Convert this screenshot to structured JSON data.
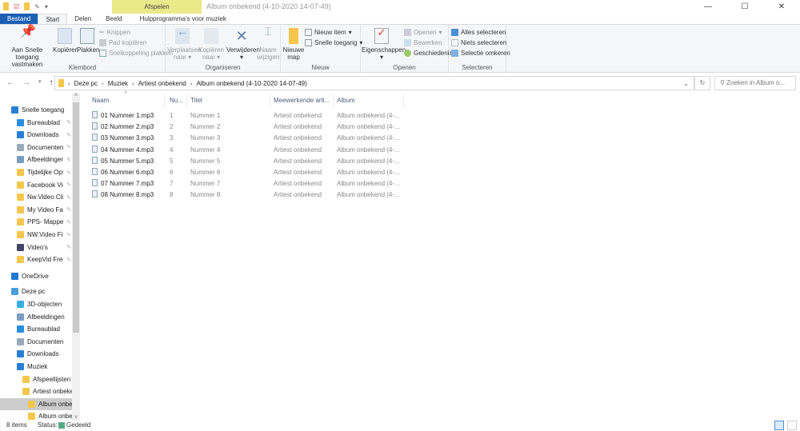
{
  "window": {
    "title": "Album onbekend (4-10-2020 14-07-49)",
    "contextual_tab": "Afspelen"
  },
  "tabs": [
    "Bestand",
    "Start",
    "Delen",
    "Beeld",
    "Hulpprogramma's voor muziek"
  ],
  "ribbon": {
    "klembord": {
      "label": "Klembord",
      "pin": "Aan Snelle toegang vastmaken",
      "copy": "Kopiëren",
      "paste": "Plakken",
      "cut": "Knippen",
      "copy_path": "Pad kopiëren",
      "paste_shortcut": "Snelkoppeling plakken"
    },
    "organiseren": {
      "label": "Organiseren",
      "move": "Verplaatsen naar",
      "copy_to": "Kopiëren naar",
      "delete": "Verwijderen",
      "rename": "Naam wijzigen"
    },
    "nieuw": {
      "label": "Nieuw",
      "new_folder": "Nieuwe map",
      "new_item": "Nieuw item",
      "easy_access": "Snelle toegang"
    },
    "openen": {
      "label": "Openen",
      "properties": "Eigenschappen",
      "open": "Openen",
      "edit": "Bewerken",
      "history": "Geschiedenis"
    },
    "selecteren": {
      "label": "Selecteren",
      "select_all": "Alles selecteren",
      "select_none": "Niets selecteren",
      "invert": "Selectie omkeren"
    }
  },
  "address": {
    "crumbs": [
      "Deze pc",
      "Muziek",
      "Artiest onbekend",
      "Album onbekend (4-10-2020 14-07-49)"
    ],
    "search_placeholder": "Zoeken in Album o..."
  },
  "nav": [
    {
      "label": "Snelle toegang",
      "icon": "star",
      "pin": false,
      "indent": 0
    },
    {
      "label": "Bureaublad",
      "icon": "desktop",
      "pin": true,
      "indent": 1
    },
    {
      "label": "Downloads",
      "icon": "download",
      "pin": true,
      "indent": 1
    },
    {
      "label": "Documenten",
      "icon": "document",
      "pin": true,
      "indent": 1
    },
    {
      "label": "Afbeeldingen",
      "icon": "picture",
      "pin": true,
      "indent": 1
    },
    {
      "label": "Tijdelijke Opslag",
      "icon": "folder",
      "pin": true,
      "indent": 1
    },
    {
      "label": "Facebook Video",
      "icon": "folder",
      "pin": true,
      "indent": 1
    },
    {
      "label": "Nw.Video Clips",
      "icon": "folder",
      "pin": true,
      "indent": 1
    },
    {
      "label": "My Video Favorieten",
      "icon": "folder",
      "pin": true,
      "indent": 1
    },
    {
      "label": "PPS- Mappen",
      "icon": "folder",
      "pin": true,
      "indent": 1
    },
    {
      "label": "NW.Video Files",
      "icon": "folder",
      "pin": true,
      "indent": 1
    },
    {
      "label": "Video's",
      "icon": "video",
      "pin": true,
      "indent": 1
    },
    {
      "label": "KeepVid Free",
      "icon": "folder",
      "pin": true,
      "indent": 1
    },
    {
      "label": "OneDrive",
      "icon": "cloud",
      "pin": false,
      "indent": 0
    },
    {
      "label": "Deze pc",
      "icon": "pc",
      "pin": false,
      "indent": 0
    },
    {
      "label": "3D-objecten",
      "icon": "cube",
      "pin": false,
      "indent": 1
    },
    {
      "label": "Afbeeldingen",
      "icon": "picture",
      "pin": false,
      "indent": 1
    },
    {
      "label": "Bureaublad",
      "icon": "desktop",
      "pin": false,
      "indent": 1
    },
    {
      "label": "Documenten",
      "icon": "document",
      "pin": false,
      "indent": 1
    },
    {
      "label": "Downloads",
      "icon": "download",
      "pin": false,
      "indent": 1
    },
    {
      "label": "Muziek",
      "icon": "music",
      "pin": false,
      "indent": 1
    },
    {
      "label": "Afspeellijsten",
      "icon": "folder",
      "pin": false,
      "indent": 2
    },
    {
      "label": "Artiest onbekend",
      "icon": "folder",
      "pin": false,
      "indent": 2
    },
    {
      "label": "Album onbekend",
      "icon": "folder",
      "pin": false,
      "indent": 3,
      "selected": true
    },
    {
      "label": "Album onbekend",
      "icon": "folder",
      "pin": false,
      "indent": 3
    }
  ],
  "columns": [
    "Naam",
    "Nu...",
    "Titel",
    "Meewerkende arti...",
    "Album"
  ],
  "files": [
    [
      "01 Nummer 1.mp3",
      "1",
      "Nummer 1",
      "Artiest onbekend",
      "Album onbekend (4-..."
    ],
    [
      "02 Nummer 2.mp3",
      "2",
      "Nummer 2",
      "Artiest onbekend",
      "Album onbekend (4-..."
    ],
    [
      "03 Nummer 3.mp3",
      "3",
      "Nummer 3",
      "Artiest onbekend",
      "Album onbekend (4-..."
    ],
    [
      "04 Nummer 4.mp3",
      "4",
      "Nummer 4",
      "Artiest onbekend",
      "Album onbekend (4-..."
    ],
    [
      "05 Nummer 5.mp3",
      "5",
      "Nummer 5",
      "Artiest onbekend",
      "Album onbekend (4-..."
    ],
    [
      "06 Nummer 6.mp3",
      "6",
      "Nummer 6",
      "Artiest onbekend",
      "Album onbekend (4-..."
    ],
    [
      "07 Nummer 7.mp3",
      "7",
      "Nummer 7",
      "Artiest onbekend",
      "Album onbekend (4-..."
    ],
    [
      "08 Nummer 8.mp3",
      "8",
      "Nummer 8",
      "Artiest onbekend",
      "Album onbekend (4-..."
    ]
  ],
  "status": {
    "count": "8 items",
    "label": "Status:",
    "value": "Gedeeld"
  }
}
